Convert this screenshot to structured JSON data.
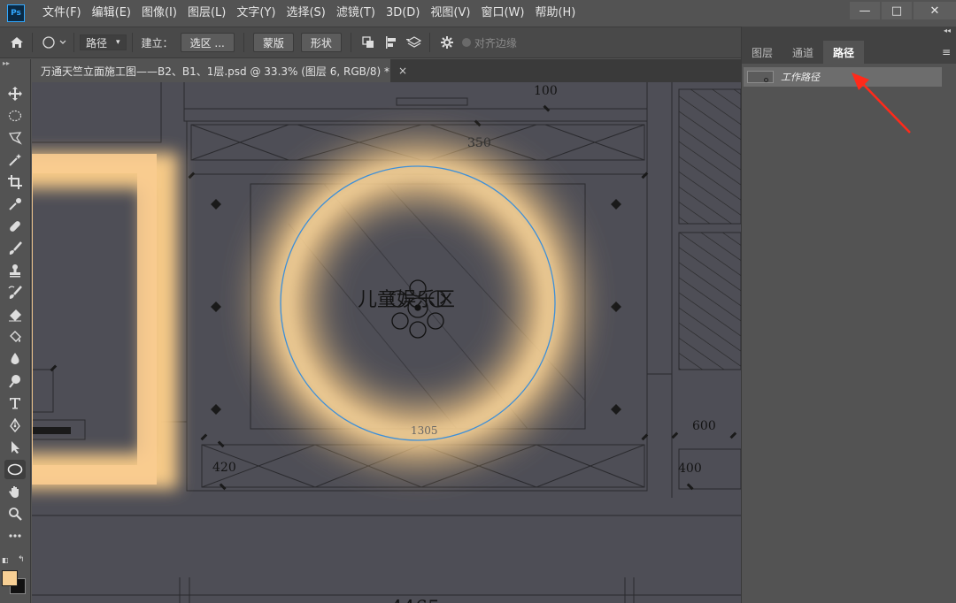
{
  "app": {
    "logo": "Ps"
  },
  "menu": [
    "文件(F)",
    "编辑(E)",
    "图像(I)",
    "图层(L)",
    "文字(Y)",
    "选择(S)",
    "滤镜(T)",
    "3D(D)",
    "视图(V)",
    "窗口(W)",
    "帮助(H)"
  ],
  "window_controls": {
    "minimize": "—",
    "maximize": "□",
    "close": "✕"
  },
  "options": {
    "mode_select": "路径",
    "make_label": "建立：",
    "selection_button": "选区 ...",
    "mask_button": "蒙版",
    "shape_button": "形状",
    "align_edges_label": "对齐边缘"
  },
  "document": {
    "tab_title": "万通天竺立面施工图——B2、B1、1层.psd @ 33.3% (图层 6, RGB/8) *",
    "close": "×"
  },
  "drawing": {
    "room_label": "儿童娱乐区",
    "dims": [
      "100",
      "350",
      "1305",
      "420",
      "600",
      "400",
      "4465"
    ]
  },
  "colors": {
    "foreground": "#f7cf94",
    "background": "#111111",
    "glow": "#ffd08a",
    "path_stroke": "#3d8fd8",
    "arrow": "#ff2a1a"
  },
  "panel": {
    "tabs": [
      "图层",
      "通道",
      "路径"
    ],
    "active_tab": "路径",
    "path_item": "工作路径",
    "menu_icon": "≡",
    "collapse": "◂◂"
  },
  "tools": [
    "move-icon",
    "marquee-ellipse-icon",
    "lasso-icon",
    "magic-wand-icon",
    "crop-icon",
    "eyedropper-icon",
    "healing-icon",
    "brush-icon",
    "stamp-icon",
    "history-brush-icon",
    "eraser-icon",
    "paint-bucket-icon",
    "blur-icon",
    "dodge-icon",
    "type-icon",
    "pen-icon",
    "path-select-icon",
    "ellipse-tool-icon",
    "hand-icon",
    "zoom-icon",
    "more-tools-icon"
  ]
}
